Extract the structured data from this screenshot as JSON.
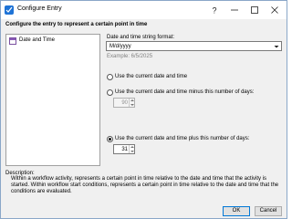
{
  "window": {
    "title": "Configure Entry",
    "icon": "app-icon",
    "controls": [
      "help-icon",
      "minimize-icon",
      "maximize-icon",
      "close-icon"
    ]
  },
  "heading": "Configure the entry to represent a certain point in time",
  "nav": {
    "items": [
      {
        "label": "Date and Time",
        "icon": "calendar-icon",
        "selected": true
      }
    ]
  },
  "format": {
    "label": "Date and time string format:",
    "value": "M/d/yyyy",
    "example": "Example: 6/5/2025"
  },
  "options": [
    {
      "label": "Use the current date and time",
      "checked": false
    },
    {
      "label": "Use the current date and time minus this number of days:",
      "checked": false,
      "days": "90"
    },
    {
      "label": "Use the current date and time plus this number of days:",
      "checked": true,
      "days": "31"
    }
  ],
  "description": {
    "label": "Description:",
    "text": "Within a workflow activity, represents a certain point in time relative to the date and time that the activity is started. Within workflow start conditions, represents a certain point in time relative to the date and time that the conditions are evaluated."
  },
  "buttons": {
    "ok": "OK",
    "cancel": "Cancel"
  }
}
